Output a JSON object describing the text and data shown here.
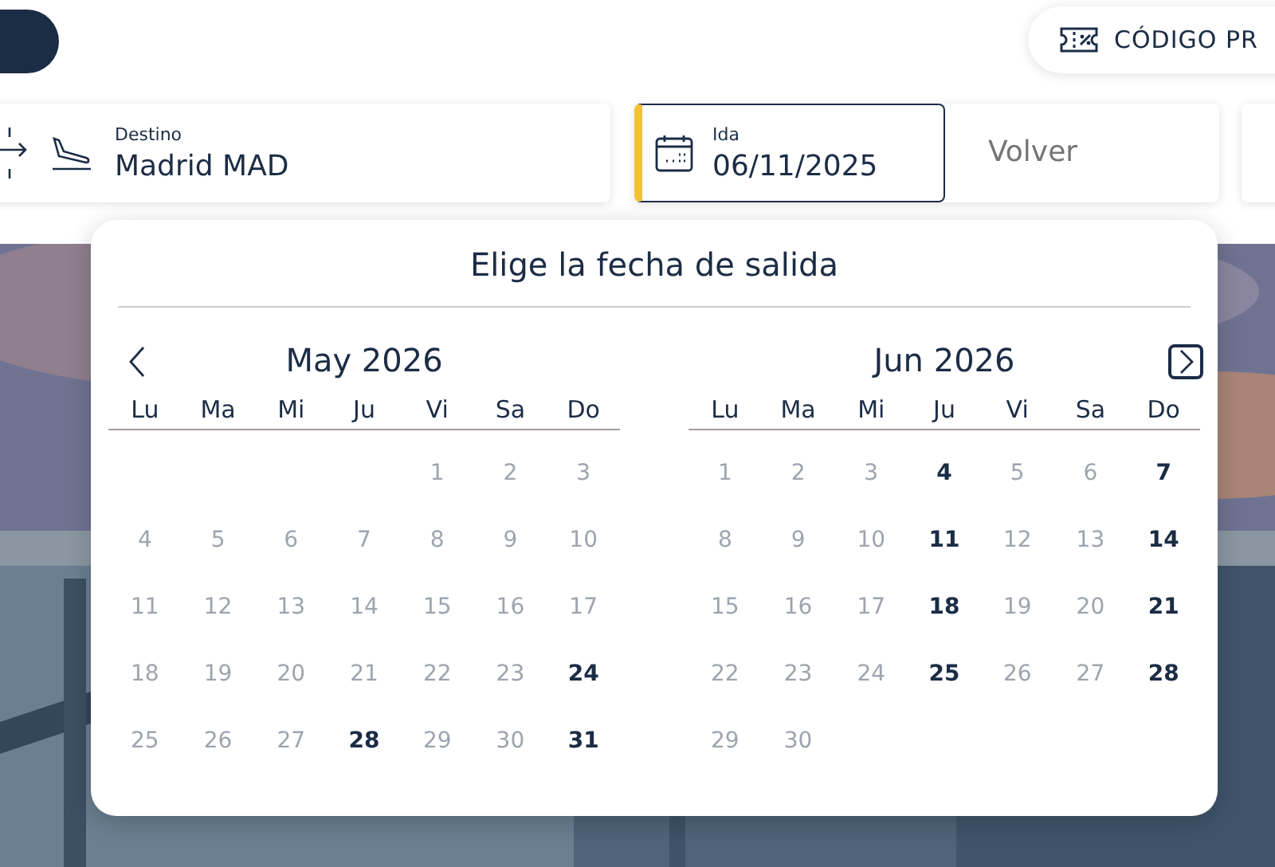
{
  "promo_button": {
    "label": "CÓDIGO PR"
  },
  "fields": {
    "destination": {
      "label": "Destino",
      "value": "Madrid MAD"
    },
    "departure": {
      "label": "Ida",
      "value": "06/11/2025",
      "selected": true
    },
    "return": {
      "placeholder": "Volver"
    }
  },
  "datepicker": {
    "title": "Elige la fecha de salida",
    "months": [
      {
        "title": "May 2026",
        "weekdays": [
          "Lu",
          "Ma",
          "Mi",
          "Ju",
          "Vi",
          "Sa",
          "Do"
        ],
        "cells": [
          {
            "kind": "blank"
          },
          {
            "kind": "blank"
          },
          {
            "kind": "blank"
          },
          {
            "kind": "blank"
          },
          {
            "kind": "day",
            "day": "1",
            "disabled": true
          },
          {
            "kind": "day",
            "day": "2",
            "disabled": true
          },
          {
            "kind": "day",
            "day": "3",
            "disabled": true
          },
          {
            "kind": "day",
            "day": "4",
            "disabled": true
          },
          {
            "kind": "day",
            "day": "5",
            "disabled": true
          },
          {
            "kind": "day",
            "day": "6",
            "disabled": true
          },
          {
            "kind": "day",
            "day": "7",
            "disabled": true
          },
          {
            "kind": "day",
            "day": "8",
            "disabled": true
          },
          {
            "kind": "day",
            "day": "9",
            "disabled": true
          },
          {
            "kind": "day",
            "day": "10",
            "disabled": true
          },
          {
            "kind": "day",
            "day": "11",
            "disabled": true
          },
          {
            "kind": "day",
            "day": "12",
            "disabled": true
          },
          {
            "kind": "day",
            "day": "13",
            "disabled": true
          },
          {
            "kind": "day",
            "day": "14",
            "disabled": true
          },
          {
            "kind": "day",
            "day": "15",
            "disabled": true
          },
          {
            "kind": "day",
            "day": "16",
            "disabled": true
          },
          {
            "kind": "day",
            "day": "17",
            "disabled": true
          },
          {
            "kind": "day",
            "day": "18",
            "disabled": true
          },
          {
            "kind": "day",
            "day": "19",
            "disabled": true
          },
          {
            "kind": "day",
            "day": "20",
            "disabled": true
          },
          {
            "kind": "day",
            "day": "21",
            "disabled": true
          },
          {
            "kind": "day",
            "day": "22",
            "disabled": true
          },
          {
            "kind": "day",
            "day": "23",
            "disabled": true
          },
          {
            "kind": "day",
            "day": "24",
            "disabled": false
          },
          {
            "kind": "day",
            "day": "25",
            "disabled": true
          },
          {
            "kind": "day",
            "day": "26",
            "disabled": true
          },
          {
            "kind": "day",
            "day": "27",
            "disabled": true
          },
          {
            "kind": "day",
            "day": "28",
            "disabled": false
          },
          {
            "kind": "day",
            "day": "29",
            "disabled": true
          },
          {
            "kind": "day",
            "day": "30",
            "disabled": true
          },
          {
            "kind": "day",
            "day": "31",
            "disabled": false
          }
        ]
      },
      {
        "title": "Jun 2026",
        "weekdays": [
          "Lu",
          "Ma",
          "Mi",
          "Ju",
          "Vi",
          "Sa",
          "Do"
        ],
        "cells": [
          {
            "kind": "day",
            "day": "1",
            "disabled": true
          },
          {
            "kind": "day",
            "day": "2",
            "disabled": true
          },
          {
            "kind": "day",
            "day": "3",
            "disabled": true
          },
          {
            "kind": "day",
            "day": "4",
            "disabled": false
          },
          {
            "kind": "day",
            "day": "5",
            "disabled": true
          },
          {
            "kind": "day",
            "day": "6",
            "disabled": true
          },
          {
            "kind": "day",
            "day": "7",
            "disabled": false
          },
          {
            "kind": "day",
            "day": "8",
            "disabled": true
          },
          {
            "kind": "day",
            "day": "9",
            "disabled": true
          },
          {
            "kind": "day",
            "day": "10",
            "disabled": true
          },
          {
            "kind": "day",
            "day": "11",
            "disabled": false
          },
          {
            "kind": "day",
            "day": "12",
            "disabled": true
          },
          {
            "kind": "day",
            "day": "13",
            "disabled": true
          },
          {
            "kind": "day",
            "day": "14",
            "disabled": false
          },
          {
            "kind": "day",
            "day": "15",
            "disabled": true
          },
          {
            "kind": "day",
            "day": "16",
            "disabled": true
          },
          {
            "kind": "day",
            "day": "17",
            "disabled": true
          },
          {
            "kind": "day",
            "day": "18",
            "disabled": false
          },
          {
            "kind": "day",
            "day": "19",
            "disabled": true
          },
          {
            "kind": "day",
            "day": "20",
            "disabled": true
          },
          {
            "kind": "day",
            "day": "21",
            "disabled": false
          },
          {
            "kind": "day",
            "day": "22",
            "disabled": true
          },
          {
            "kind": "day",
            "day": "23",
            "disabled": true
          },
          {
            "kind": "day",
            "day": "24",
            "disabled": true
          },
          {
            "kind": "day",
            "day": "25",
            "disabled": false
          },
          {
            "kind": "day",
            "day": "26",
            "disabled": true
          },
          {
            "kind": "day",
            "day": "27",
            "disabled": true
          },
          {
            "kind": "day",
            "day": "28",
            "disabled": false
          },
          {
            "kind": "day",
            "day": "29",
            "disabled": true
          },
          {
            "kind": "day",
            "day": "30",
            "disabled": true
          }
        ]
      }
    ]
  }
}
